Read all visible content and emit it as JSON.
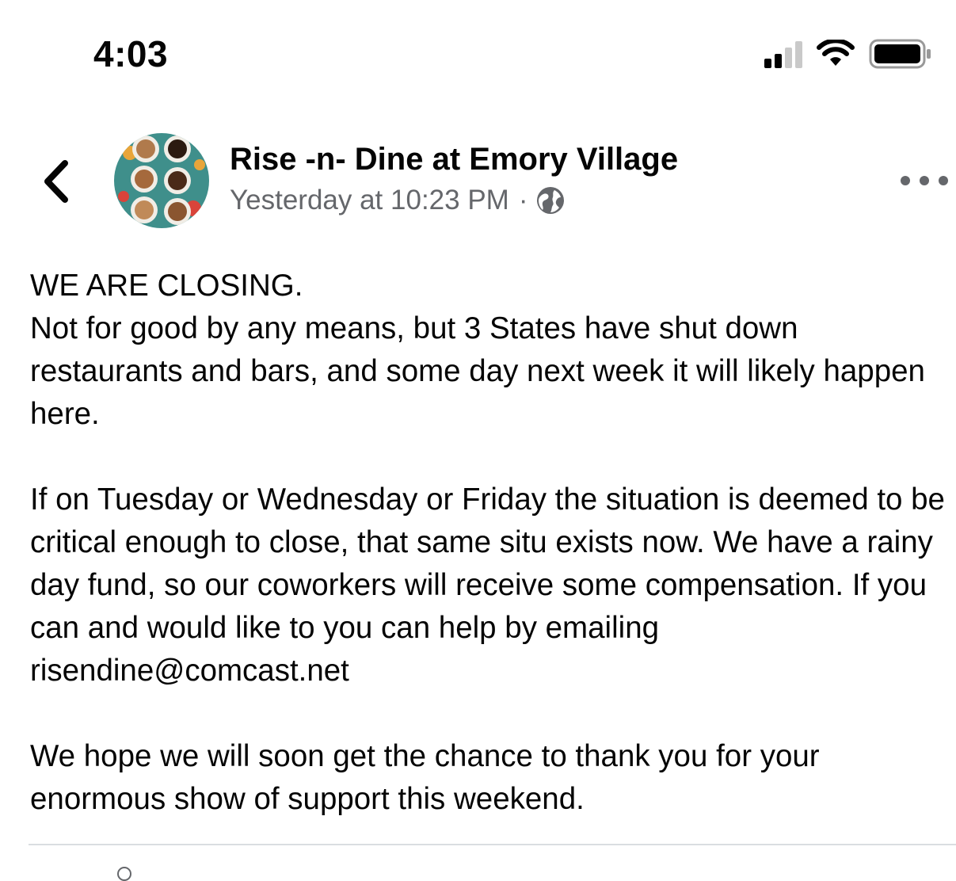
{
  "status_bar": {
    "time": "4:03",
    "icons": [
      "cellular-signal-icon",
      "wifi-icon",
      "battery-icon"
    ]
  },
  "header": {
    "back_icon": "chevron-left-icon",
    "page_name": "Rise -n- Dine at Emory Village",
    "timestamp": "Yesterday at 10:23 PM",
    "separator": "·",
    "audience_icon": "globe-icon",
    "more_icon": "more-horizontal-icon"
  },
  "post": {
    "paragraphs": [
      "WE ARE CLOSING.\nNot for good by any means, but 3 States have shut down restaurants and bars, and some day next week it will likely happen here.",
      "If on Tuesday or Wednesday or Friday the situation is deemed to be critical enough to close, that same situ exists now. We have a rainy day fund, so our coworkers will receive some compensation. If you can and would like to you can help by emailing risendine@comcast.net",
      "We hope we will soon get the chance to thank you for your enormous show of support this weekend."
    ]
  },
  "colors": {
    "text_primary": "#050505",
    "text_secondary": "#65676b",
    "divider": "#dadde1"
  }
}
